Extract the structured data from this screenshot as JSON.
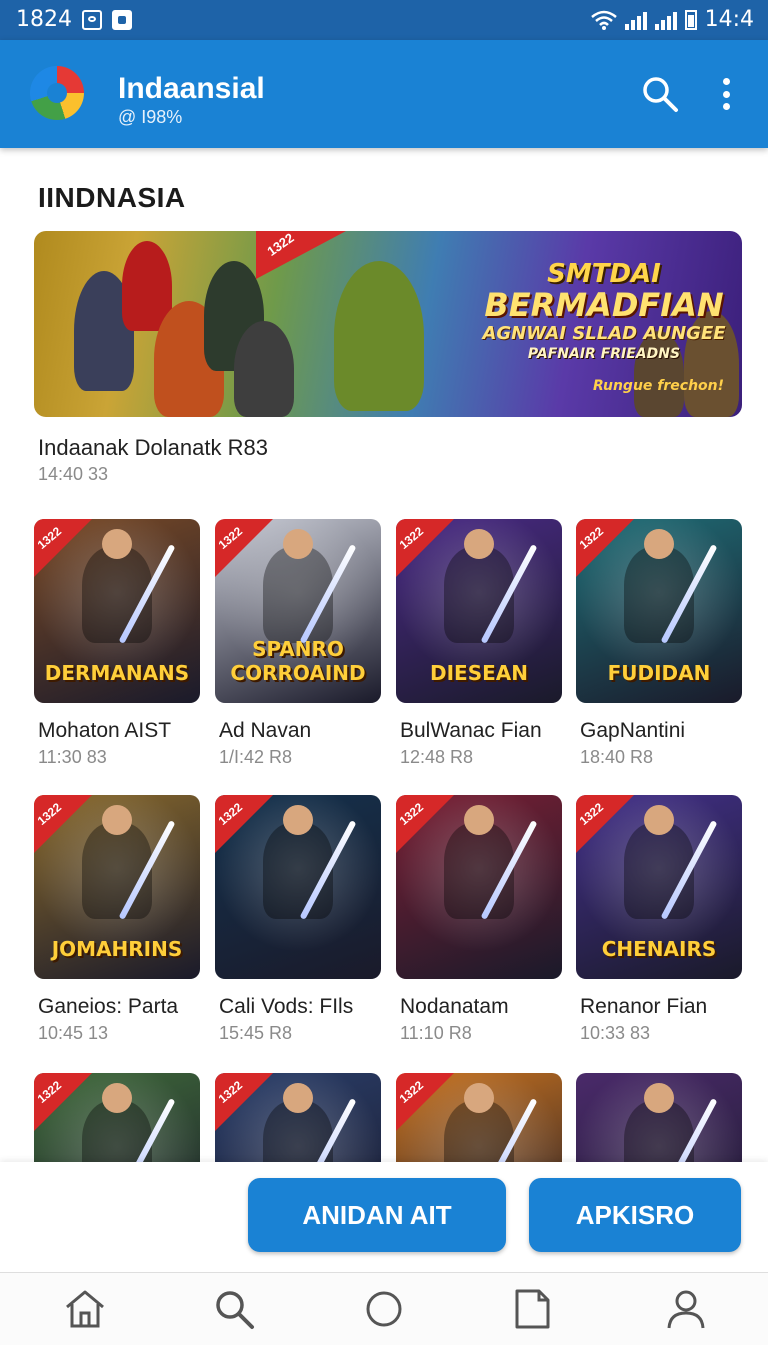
{
  "status_bar": {
    "time_left": "1824",
    "time_right": "14:4"
  },
  "app_bar": {
    "title": "Indaansial",
    "subtitle": "@ I98%"
  },
  "section": {
    "title": "IINDNASIA"
  },
  "banner": {
    "ribbon": "1322",
    "headline_1": "SMTDAI",
    "headline_2": "BERMADFIAN",
    "headline_3": "AGNWAI SLLAD AUNGEE",
    "headline_4": "PAFNAIR FRIEADNS",
    "headline_5": "Rungue frechon!",
    "title": "Indaanak Dolanatk R83",
    "time": "14:40 33"
  },
  "tiles": [
    {
      "ribbon": "1322",
      "label": "DERMANANS",
      "title": "Mohaton AIST",
      "time": "11:30 83",
      "bg": "#7a4a26"
    },
    {
      "ribbon": "1322",
      "label": "SPANRO CORROAIND",
      "title": "Ad Navan",
      "time": "1/I:42 R8",
      "bg": "#c9ccd6"
    },
    {
      "ribbon": "1322",
      "label": "DIESEAN",
      "title": "BulWanac Fian",
      "time": "12:48 R8",
      "bg": "#4a2a86"
    },
    {
      "ribbon": "1322",
      "label": "FUDIDAN",
      "title": "GapNantini",
      "time": "18:40 R8",
      "bg": "#1f6f78"
    },
    {
      "ribbon": "1322",
      "label": "JOMAHRINS",
      "title": "Ganeios: Parta",
      "time": "10:45 13",
      "bg": "#8a6a2c"
    },
    {
      "ribbon": "1322",
      "label": "",
      "title": "Cali Vods: FIls",
      "time": "15:45 R8",
      "bg": "#14324e"
    },
    {
      "ribbon": "1322",
      "label": "",
      "title": "Nodanatam",
      "time": "11:10 R8",
      "bg": "#7a1f34"
    },
    {
      "ribbon": "1322",
      "label": "CHENAIRS",
      "title": "Renanor Fian",
      "time": "10:33 83",
      "bg": "#43308a"
    },
    {
      "ribbon": "1322",
      "label": "",
      "title": "",
      "time": "",
      "bg": "#3f6a3a"
    },
    {
      "ribbon": "1322",
      "label": "",
      "title": "",
      "time": "",
      "bg": "#2a3e6a"
    },
    {
      "ribbon": "1322",
      "label": "",
      "title": "",
      "time": "",
      "bg": "#c8721e"
    },
    {
      "ribbon": "",
      "label": "",
      "title": "",
      "time": "",
      "bg": "#4a2a6a"
    }
  ],
  "actions": {
    "primary": "ANIDAN AIT",
    "secondary": "APKISRO"
  },
  "nav": [
    "home-icon",
    "search-icon",
    "circle-icon",
    "document-icon",
    "profile-icon"
  ],
  "colors": {
    "status_bar": "#1e63a8",
    "app_bar": "#1a82d4",
    "button": "#1a82d4",
    "ribbon": "#d62828"
  }
}
